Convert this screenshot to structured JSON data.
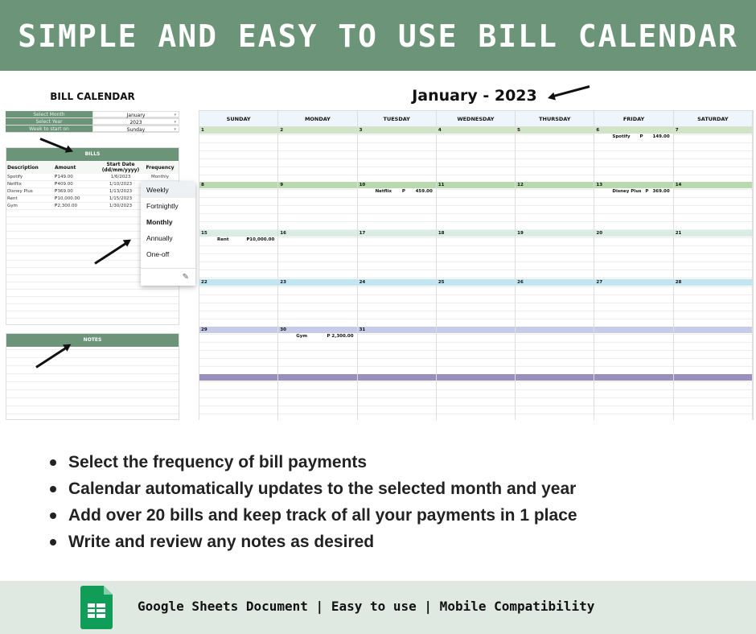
{
  "banner": {
    "title": "SIMPLE AND EASY TO USE BILL CALENDAR"
  },
  "sheet": {
    "title": "BILL CALENDAR",
    "settings": [
      {
        "label": "Select Month",
        "value": "January"
      },
      {
        "label": "Select Year",
        "value": "2023"
      },
      {
        "label": "Week to start on",
        "value": "Sunday"
      }
    ],
    "bills_header": "BILLS",
    "columns": [
      "Description",
      "Amount",
      "Start Date (dd/mm/yyyy)",
      "Frequency"
    ],
    "bills": [
      {
        "description": "Spotify",
        "amount": "₱149.00",
        "start": "1/6/2023",
        "frequency": "Monthly"
      },
      {
        "description": "Netflix",
        "amount": "₱409.00",
        "start": "1/10/2023",
        "frequency": ""
      },
      {
        "description": "Disney Plus",
        "amount": "₱369.00",
        "start": "1/13/2023",
        "frequency": ""
      },
      {
        "description": "Rent",
        "amount": "₱10,000.00",
        "start": "1/15/2023",
        "frequency": ""
      },
      {
        "description": "Gym",
        "amount": "₱2,300.00",
        "start": "1/30/2023",
        "frequency": ""
      }
    ],
    "frequency_options": [
      "Weekly",
      "Fortnightly",
      "Monthly",
      "Annually",
      "One-off"
    ],
    "frequency_selected": "Monthly",
    "notes_header": "NOTES"
  },
  "calendar": {
    "title": "January - 2023",
    "days": [
      "SUNDAY",
      "MONDAY",
      "TUESDAY",
      "WEDNESDAY",
      "THURSDAY",
      "FRIDAY",
      "SATURDAY"
    ],
    "weeks": [
      {
        "color": "#cfe5c6",
        "dates": [
          "1",
          "2",
          "3",
          "4",
          "5",
          "6",
          "7"
        ]
      },
      {
        "color": "#b9d9ae",
        "dates": [
          "8",
          "9",
          "10",
          "11",
          "12",
          "13",
          "14"
        ]
      },
      {
        "color": "#d9ede4",
        "dates": [
          "15",
          "16",
          "17",
          "18",
          "19",
          "20",
          "21"
        ]
      },
      {
        "color": "#c0e6f3",
        "dates": [
          "22",
          "23",
          "24",
          "25",
          "26",
          "27",
          "28"
        ]
      },
      {
        "color": "#c6cbe8",
        "dates": [
          "29",
          "30",
          "31",
          "",
          "",
          "",
          ""
        ]
      },
      {
        "color": "#9b90bd",
        "dates": [
          "",
          "",
          "",
          "",
          "",
          "",
          ""
        ]
      }
    ],
    "events": [
      {
        "week": 0,
        "day": 5,
        "name": "Spotify",
        "currency": "P",
        "amount": "149.00"
      },
      {
        "week": 1,
        "day": 2,
        "name": "Netflix",
        "currency": "P",
        "amount": "459.00"
      },
      {
        "week": 1,
        "day": 5,
        "name": "Disney Plus",
        "currency": "P",
        "amount": "369.00"
      },
      {
        "week": 2,
        "day": 0,
        "name": "Rent",
        "currency": "",
        "amount": "₱10,000.00"
      },
      {
        "week": 4,
        "day": 1,
        "name": "Gym",
        "currency": "",
        "amount": "P 2,300.00"
      }
    ]
  },
  "features": [
    "Select the frequency of bill payments",
    "Calendar automatically updates to the selected month and year",
    "Add over 20 bills and keep track of all your payments in 1 place",
    "Write and review any notes as desired"
  ],
  "footer": {
    "text": "Google Sheets Document | Easy to use | Mobile Compatibility",
    "icon": "google-sheets-icon",
    "brand_color": "#0f9d58"
  }
}
